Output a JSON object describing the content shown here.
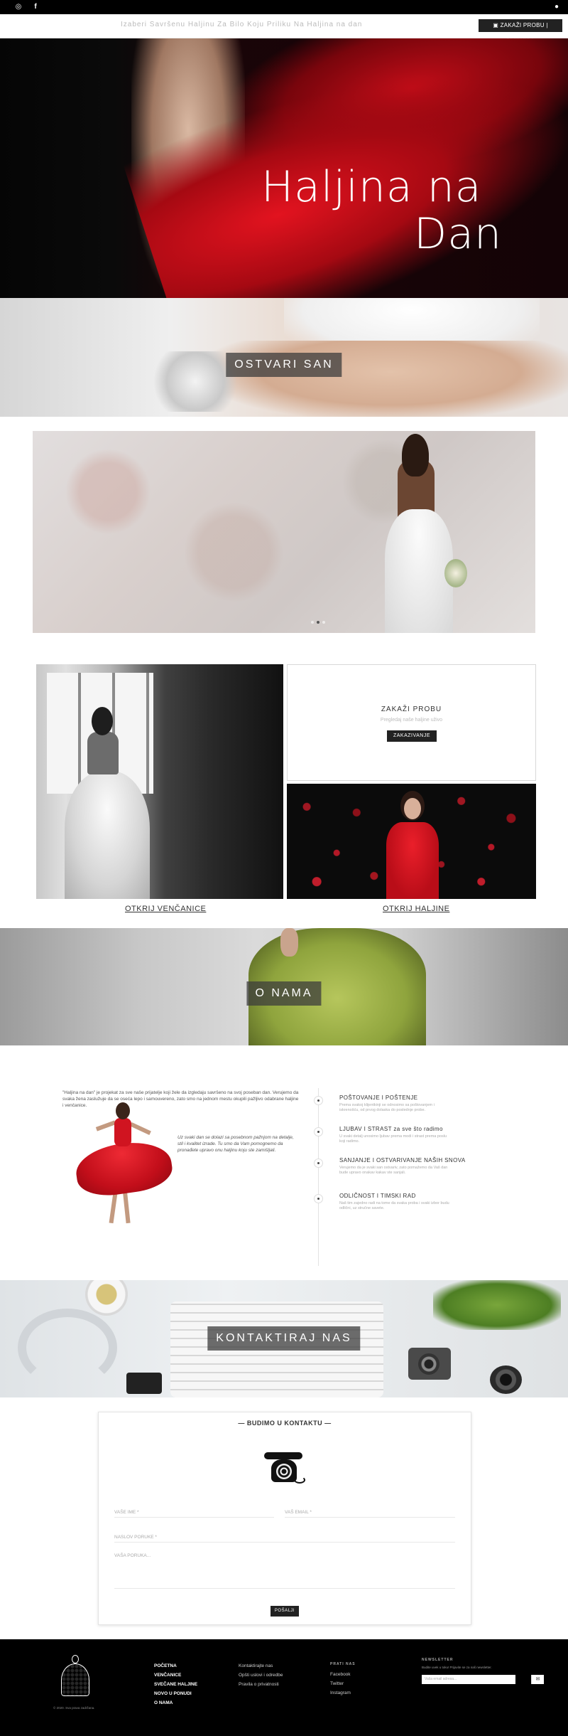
{
  "topbar": {
    "instagram_icon": "instagram-icon",
    "facebook_icon": "facebook-icon",
    "user_icon": "user-icon"
  },
  "nav": {
    "ticker": "Izaberi Savršenu Haljinu Za Bilo Koju Priliku Na Haljina na dan",
    "cta": "ZAKAŽI PROBU | KONTAKT",
    "cta_icon": "calendar-icon"
  },
  "hero": {
    "title_line1": "Haljina na",
    "title_line2": "Dan"
  },
  "banner_dream": {
    "label": "OSTVARI SAN"
  },
  "slider": {
    "slides_count": 3,
    "active_slide": 1
  },
  "grid": {
    "card_title": "ZAKAŽI PROBU",
    "card_subtitle": "Pregledaj naše haljine uživo",
    "card_button": "ZAKAZIVANJE",
    "link_vencanice": "OTKRIJ VENČANICE",
    "link_haljine": "OTKRIJ HALJINE"
  },
  "banner_about": {
    "label": "O NAMA"
  },
  "about": {
    "intro": "\"Haljina na dan\" je projekat za sve naše prijatelje koji žele da izgledaju savršeno na svoj poseban dan. Verujemo da svaka žena zaslužuje da se oseća lepo i samouvereno, zato smo na jednom mestu okupili pažljivo odabrane haljine i venčanice.",
    "quote": "Uz svaki dan se dolazi sa posebnom pažnjom na detalje, stil i kvalitet izrade. Tu smo da Vam pomognemo da pronađete upravo onu haljinu koju ste zamišljali.",
    "items": [
      {
        "title": "POŠTOVANJE I POŠTENJE",
        "desc": "Prema svakoj klijentkinji se odnosimo sa poštovanjem i iskrenošću, od prvog dolaska do poslednje probe."
      },
      {
        "title": "LJUBAV I STRAST za sve što radimo",
        "desc": "U svaki detalj unosimo ljubav prema modi i strast prema poslu koji radimo."
      },
      {
        "title": "SANJANJE I OSTVARIVANJE NAŠIH SNOVA",
        "desc": "Verujemo da je svaki san ostvariv, zato pomažemo da Vaš dan bude upravo onakav kakav ste sanjali."
      },
      {
        "title": "ODLIČNOST I TIMSKI RAD",
        "desc": "Naš tim zajedno radi na tome da svaka proba i svaki izbor budu odlični, uz stručne savete."
      }
    ]
  },
  "banner_contact": {
    "label": "KONTAKTIRAJ NAS"
  },
  "contact": {
    "heading": "BUDIMO U KONTAKTU",
    "name_placeholder": "VAŠE IME *",
    "email_placeholder": "VAŠ EMAIL *",
    "subject_placeholder": "NASLOV PORUKE *",
    "message_placeholder": "VAŠA PORUKA...",
    "send": "POŠALJI",
    "telephone_icon": "telephone-icon"
  },
  "footer": {
    "copyright": "© 2020. Sva prava zadržana.",
    "nav": [
      "POČETNA",
      "VENČANICE",
      "SVEČANE HALJINE",
      "NOVO U PONUDI",
      "O NAMA"
    ],
    "links": [
      "Kontaktirajte nas",
      "Opšti uslovi i odredbe",
      "Pravila o privatnosti"
    ],
    "follow_heading": "PRATI NAS",
    "social": [
      "Facebook",
      "Twitter",
      "Instagram"
    ],
    "newsletter_heading": "NEWSLETTER",
    "newsletter_text": "Budite uvek u toku! Prijavite se za naš newsletter.",
    "newsletter_placeholder": "Vaša email adresa...",
    "newsletter_button_icon": "mail-icon"
  }
}
